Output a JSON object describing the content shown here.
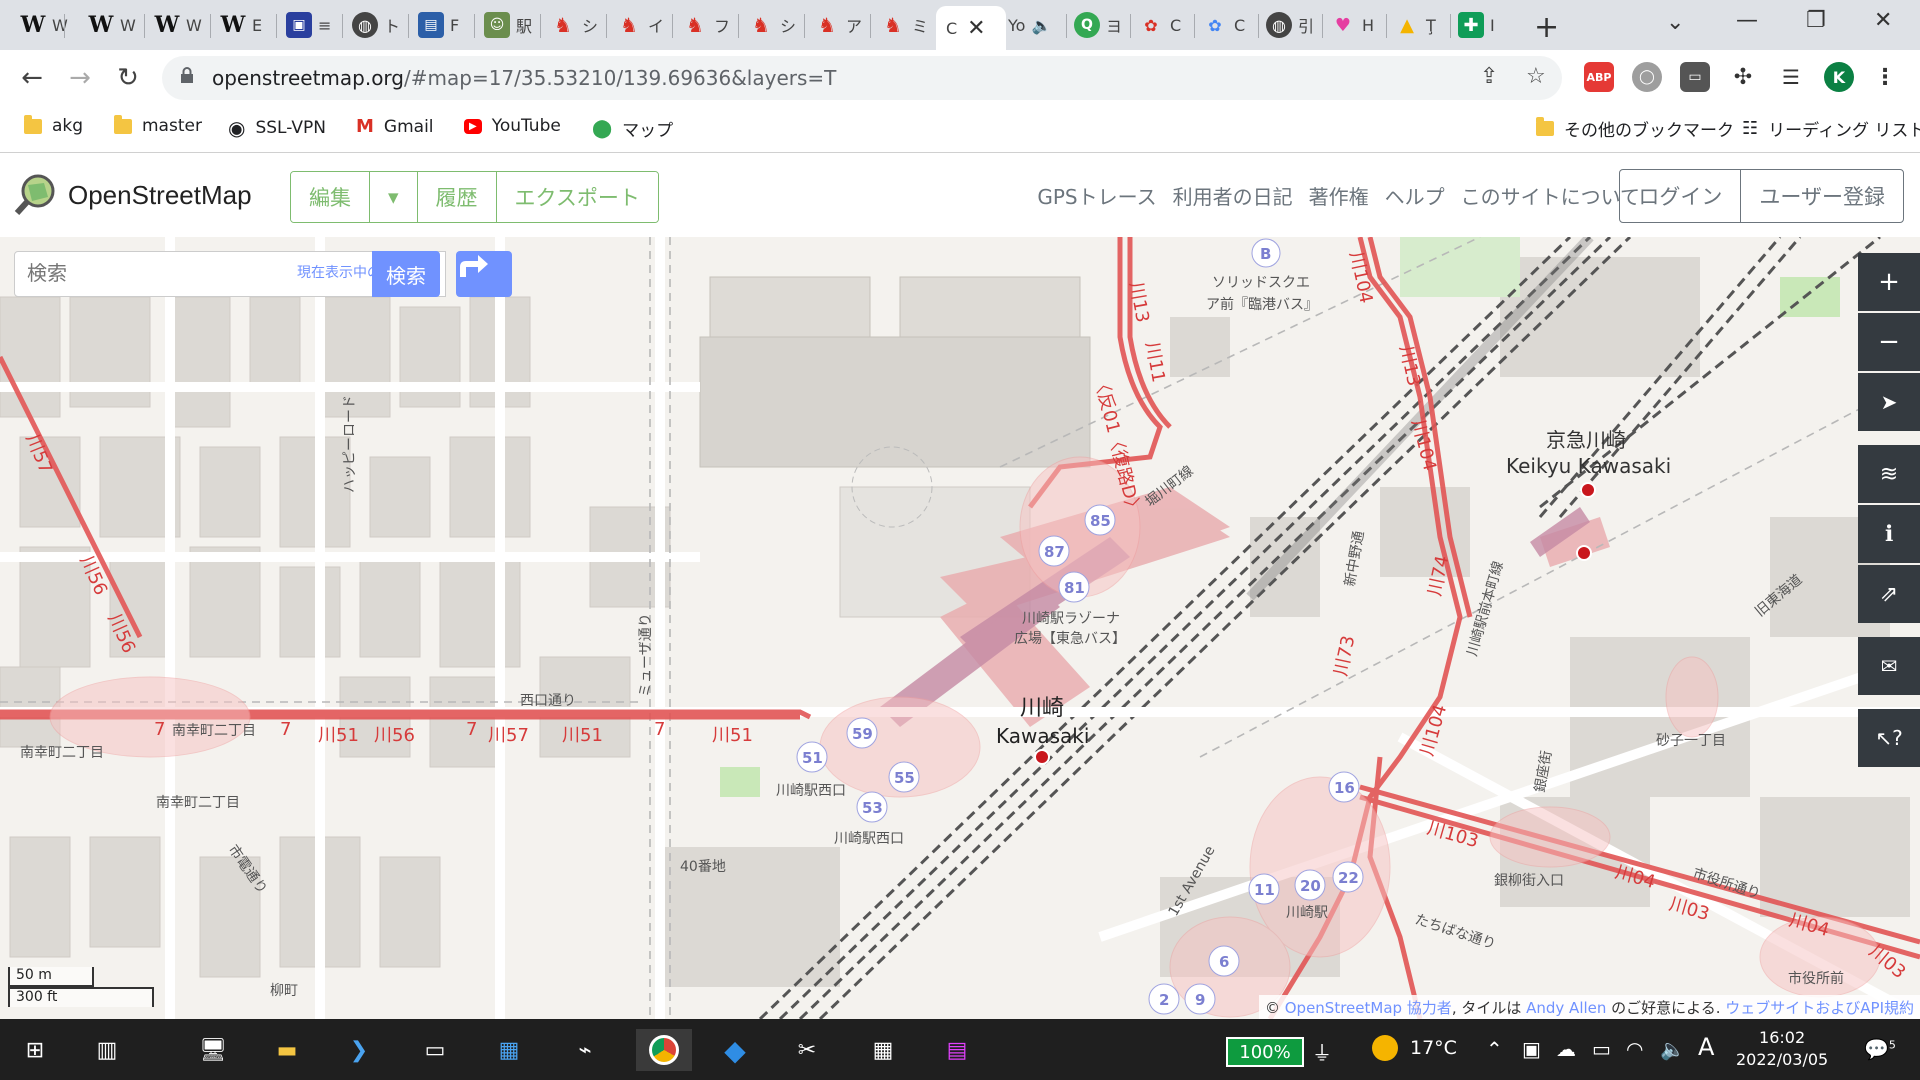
{
  "browser": {
    "tabs": [
      {
        "icon": "W",
        "label": "W"
      },
      {
        "icon": "W",
        "label": "W"
      },
      {
        "icon": "W",
        "label": "W"
      },
      {
        "icon": "W",
        "label": "E"
      },
      {
        "icon": "train",
        "label": "≡"
      },
      {
        "icon": "globe",
        "label": "ト"
      },
      {
        "icon": "bus",
        "label": "F"
      },
      {
        "icon": "person",
        "label": "駅"
      },
      {
        "icon": "pin",
        "label": "シ"
      },
      {
        "icon": "pin",
        "label": "イ"
      },
      {
        "icon": "pin",
        "label": "フ"
      },
      {
        "icon": "pin",
        "label": "シ"
      },
      {
        "icon": "pin",
        "label": "ア"
      },
      {
        "icon": "pin",
        "label": "ミ"
      },
      {
        "icon": "osm",
        "label": "C",
        "active": true
      },
      {
        "icon": "youtube",
        "label": "Yo"
      },
      {
        "icon": "green-circle",
        "label": "ヨ"
      },
      {
        "icon": "chrome-c",
        "label": "C"
      },
      {
        "icon": "chrome-c",
        "label": "C"
      },
      {
        "icon": "globe",
        "label": "引"
      },
      {
        "icon": "heart",
        "label": "H"
      },
      {
        "icon": "drive",
        "label": "Ţ"
      },
      {
        "icon": "plus-square",
        "label": "I"
      }
    ],
    "url_host": "openstreetmap.org",
    "url_rest": "/#map=17/35.53210/139.69636&layers=T",
    "profile_initial": "K",
    "bookmarks": [
      {
        "label": "akg",
        "icon": "folder"
      },
      {
        "label": "master",
        "icon": "folder"
      },
      {
        "label": "SSL-VPN",
        "icon": "globe"
      },
      {
        "label": "Gmail",
        "icon": "gmail"
      },
      {
        "label": "YouTube",
        "icon": "youtube"
      },
      {
        "label": "マップ",
        "icon": "maps-pin"
      }
    ],
    "other_bookmarks": "その他のブックマーク",
    "reading_list": "リーディング リスト"
  },
  "osm": {
    "site_title": "OpenStreetMap",
    "edit_label": "編集",
    "history_label": "履歴",
    "export_label": "エクスポート",
    "nav": [
      "GPSトレース",
      "利用者の日記",
      "著作権",
      "ヘルプ",
      "このサイトについて"
    ],
    "login_label": "ログイン",
    "signup_label": "ユーザー登録",
    "search_placeholder": "検索",
    "where_am_i": "現在表示中の位置情報",
    "search_button": "検索",
    "scale_m": "50 m",
    "scale_ft": "300 ft",
    "attribution": {
      "pre": "© ",
      "osm_link": "OpenStreetMap 協力者",
      "mid": ", タイルは ",
      "andy_link": "Andy Allen",
      "mid2": " のご好意による. ",
      "api_link": "ウェブサイトおよびAPI規約"
    }
  },
  "map": {
    "labels": {
      "keikyu_jp": "京急川崎",
      "keikyu_en": "Keikyu Kawasaki",
      "kawasaki_jp": "川崎",
      "kawasaki_en": "Kawasaki",
      "solid_square": "ソリッドスクエ",
      "solid_square2": "ア前『臨港バス』",
      "lazona": "川崎駅ラゾーナ",
      "lazona2": "広場【東急バス】",
      "nishiguchi_dori": "西口通り",
      "kawasaki_nishiguchi": "川崎駅西口",
      "kawasaki_nishiguchi2": "川崎駅西口",
      "minamisaiwai_1": "南幸町二丁目",
      "minamisaiwai_2": "南幸町二丁目",
      "minamisaiwai_3": "南幸町二丁目",
      "kawasaki_eki": "川崎駅",
      "ginryu": "銀柳街入口",
      "sunago": "砂子一丁目",
      "shiyakusho_mae": "市役所前",
      "shiyakusho_dori": "市役所通り",
      "tachibana": "たちばな通り",
      "first_avenue": "1st Avenue",
      "ginryugai": "銀座街",
      "horikawacho": "堀川町線",
      "kyu_tokaido": "旧東海道",
      "yanagimachi": "柳町",
      "shiden": "市電通り",
      "banchi40": "40番地",
      "happy_road": "ハッピーロード",
      "museum_dori": "ミューザ通り",
      "fukkou_lane": "〈反01〈復路D〉",
      "kawasaki_ekimae": "川崎駅前本町線",
      "shintyu": "新中野通"
    },
    "route_labels": {
      "r57": "川57",
      "r56a": "川56",
      "r56b": "川56",
      "r7a": "7",
      "r7b": "7",
      "r51a": "川51",
      "r56c": "川56",
      "r7c": "7",
      "r57b": "川57",
      "r51b": "川51",
      "r7d": "7",
      "r51c": "川51",
      "r133": "川13",
      "r11": "川11",
      "r104": "川104",
      "r13": "川13",
      "r104b": "川104",
      "r74": "川74",
      "r73": "川73",
      "r104c": "川104",
      "r103": "川103",
      "r104d": "川04",
      "r103b": "川03",
      "r104e": "川04",
      "r103c": "川03"
    },
    "stops": [
      "85",
      "87",
      "81",
      "59",
      "51",
      "55",
      "53",
      "16",
      "11",
      "20",
      "22",
      "6",
      "2",
      "9",
      "B"
    ]
  },
  "taskbar": {
    "battery": "100%",
    "temperature": "17°C",
    "ime": "A",
    "time": "16:02",
    "date": "2022/03/05",
    "notifications": "5"
  }
}
